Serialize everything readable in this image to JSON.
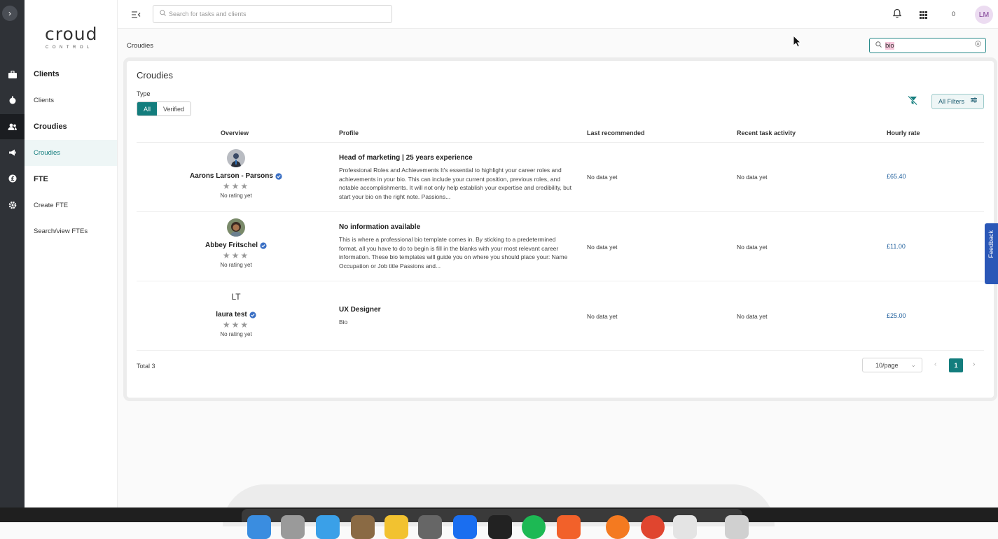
{
  "app": {
    "logo_main": "croud",
    "logo_sub": "CONTROL"
  },
  "nav": {
    "clients_heading": "Clients",
    "clients_item": "Clients",
    "croudies_heading": "Croudies",
    "croudies_item": "Croudies",
    "fte_heading": "FTE",
    "create_fte": "Create FTE",
    "search_ftes": "Search/view FTEs"
  },
  "topbar": {
    "search_placeholder": "Search for tasks and clients",
    "notification_count": "0",
    "avatar_initials": "LM"
  },
  "breadcrumb": "Croudies",
  "filter_search_value": "bio",
  "page": {
    "title": "Croudies",
    "type_label": "Type",
    "type_options": [
      "All",
      "Verified"
    ],
    "type_selected": "All",
    "all_filters": "All Filters"
  },
  "table": {
    "columns": [
      "Overview",
      "Profile",
      "Last recommended",
      "Recent task activity",
      "Hourly rate"
    ],
    "rows": [
      {
        "name": "Aarons Larson - Parsons",
        "verified": true,
        "rating": "No rating yet",
        "profile_title": "Head of marketing | 25 years experience",
        "profile_bio": "Professional Roles and Achievements It's essential to highlight your career roles and achievements in your bio. This can include your current position, previous roles, and notable accomplishments. It will not only help establish your expertise and credibility, but start your bio on the right note. Passions...",
        "last_recommended": "No data yet",
        "recent_activity": "No data yet",
        "hourly_rate": "£65.40"
      },
      {
        "name": "Abbey Fritschel",
        "verified": true,
        "rating": "No rating yet",
        "profile_title": "No information available",
        "profile_bio": "This is where a professional bio template comes in. By sticking to a predetermined format, all you have to do to begin is fill in the blanks with your most relevant career information. These bio templates will guide you on where you should place your: Name Occupation or Job title Passions and...",
        "last_recommended": "No data yet",
        "recent_activity": "No data yet",
        "hourly_rate": "£11.00"
      },
      {
        "initials": "LT",
        "name": "laura test",
        "verified": true,
        "rating": "No rating yet",
        "profile_title": "UX Designer",
        "profile_bio": "Bio",
        "last_recommended": "No data yet",
        "recent_activity": "No data yet",
        "hourly_rate": "£25.00"
      }
    ]
  },
  "pagination": {
    "total": "Total 3",
    "page_size": "10/page",
    "current_page": "1"
  },
  "feedback": "Feedback",
  "colors": {
    "accent": "#137d7d",
    "rail": "#2f3237",
    "rate_link": "#1f5f9c",
    "feedback": "#2a57b7"
  }
}
